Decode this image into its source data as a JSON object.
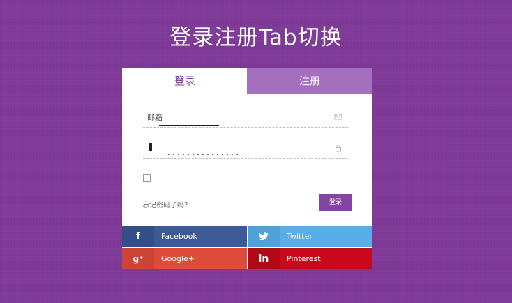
{
  "page": {
    "title": "登录注册Tab切换"
  },
  "tabs": [
    {
      "label": "登录",
      "active": true
    },
    {
      "label": "注册",
      "active": false
    }
  ],
  "form": {
    "email_label": "邮箱",
    "password_value": "",
    "remember_checked": false,
    "forgot_text": "忘记密码了吗?",
    "submit_label": "登录"
  },
  "social": [
    {
      "label": "Facebook",
      "icon": "facebook-icon"
    },
    {
      "label": "Twitter",
      "icon": "twitter-icon"
    },
    {
      "label": "Google+",
      "icon": "google-plus-icon"
    },
    {
      "label": "Pinterest",
      "icon": "linkedin-icon"
    }
  ],
  "colors": {
    "background": "#7f3a98",
    "accent": "#8544a5",
    "tab_inactive": "#a46fbd",
    "facebook": "#3c5a98",
    "twitter": "#58aee9",
    "google": "#dd4c3b",
    "pinterest": "#c8091b"
  }
}
